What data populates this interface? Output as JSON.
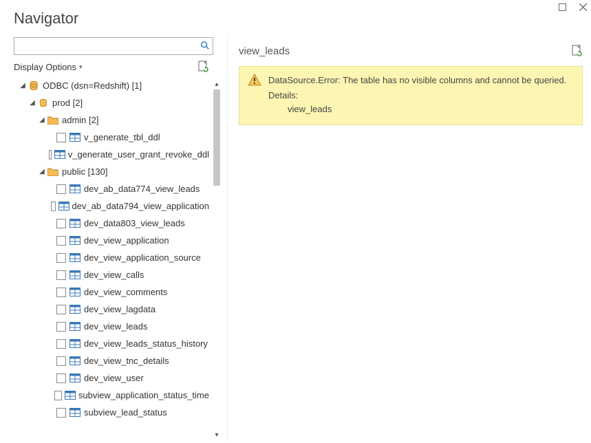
{
  "window": {
    "title": "Navigator"
  },
  "search": {
    "placeholder": ""
  },
  "display_options": {
    "label": "Display Options"
  },
  "tree": {
    "root": {
      "label": "ODBC (dsn=Redshift) [1]",
      "db": {
        "label": "prod [2]",
        "schemas": [
          {
            "label": "admin [2]",
            "items": [
              "v_generate_tbl_ddl",
              "v_generate_user_grant_revoke_ddl"
            ]
          },
          {
            "label": "public [130]",
            "items": [
              "dev_ab_data774_view_leads",
              "dev_ab_data794_view_application",
              "dev_data803_view_leads",
              "dev_view_application",
              "dev_view_application_source",
              "dev_view_calls",
              "dev_view_comments",
              "dev_view_lagdata",
              "dev_view_leads",
              "dev_view_leads_status_history",
              "dev_view_tnc_details",
              "dev_view_user",
              "subview_application_status_time",
              "subview_lead_status"
            ]
          }
        ]
      }
    }
  },
  "right": {
    "title": "view_leads",
    "error": {
      "message": "DataSource.Error: The table has no visible columns and cannot be queried.",
      "details_label": "Details:",
      "details_value": "view_leads"
    }
  }
}
